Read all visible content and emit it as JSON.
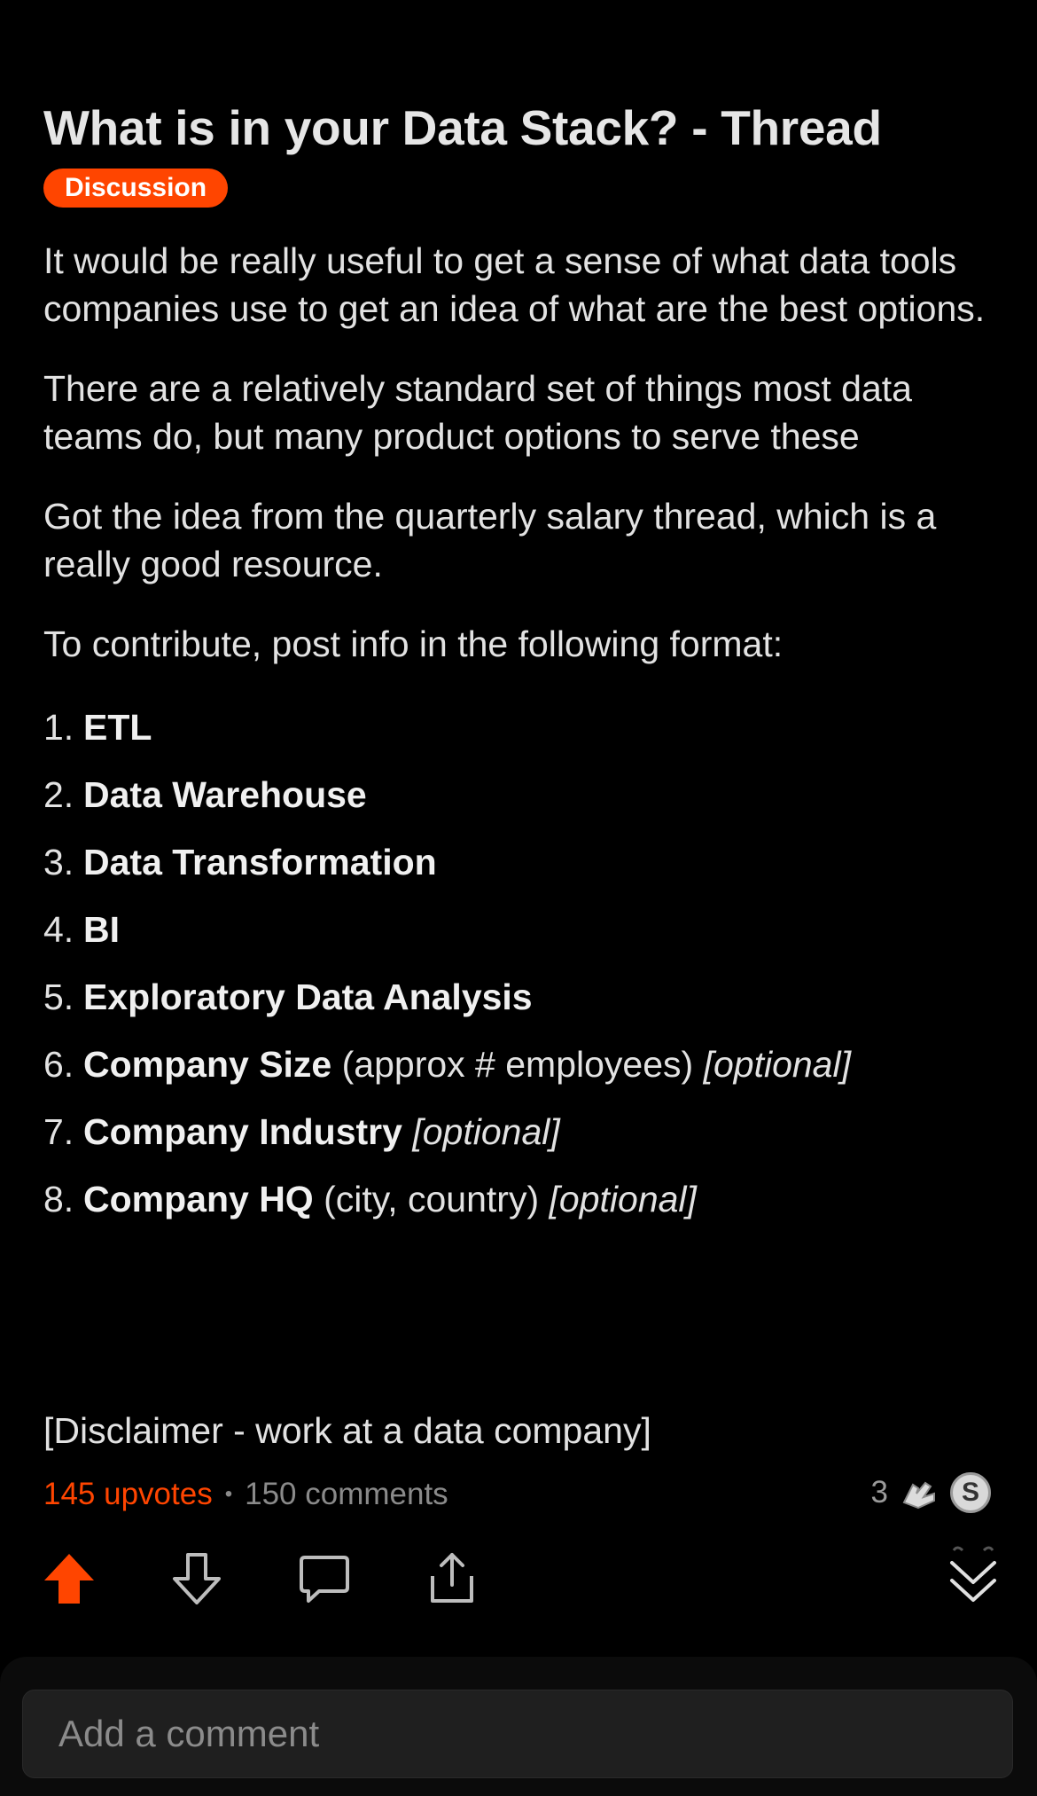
{
  "post": {
    "title": "What is in your Data Stack? - Thread",
    "flair": "Discussion",
    "paragraphs": [
      "It would be really useful to get a sense of what data tools companies use to get an idea of what are the best options.",
      "There are a relatively standard set of things most data teams do, but many product options to serve these",
      "Got the idea from the quarterly salary thread, which is a really good resource.",
      "To contribute, post info in the following format:"
    ],
    "list": [
      {
        "num": "1.",
        "bold": "ETL",
        "plain": "",
        "italic": ""
      },
      {
        "num": "2.",
        "bold": "Data Warehouse",
        "plain": "",
        "italic": ""
      },
      {
        "num": "3.",
        "bold": "Data Transformation",
        "plain": "",
        "italic": ""
      },
      {
        "num": "4.",
        "bold": "BI",
        "plain": "",
        "italic": ""
      },
      {
        "num": "5.",
        "bold": "Exploratory Data Analysis",
        "plain": "",
        "italic": ""
      },
      {
        "num": "6.",
        "bold": "Company Size",
        "plain": "(approx # employees)",
        "italic": "[optional]"
      },
      {
        "num": "7.",
        "bold": "Company Industry",
        "plain": "",
        "italic": "[optional]"
      },
      {
        "num": "8.",
        "bold": "Company HQ",
        "plain": "(city, country)",
        "italic": "[optional]"
      }
    ],
    "disclaimer": "[Disclaimer - work at a data company]",
    "upvotes": "145 upvotes",
    "separator": "•",
    "comments": "150 comments",
    "award_count": "3"
  },
  "actions": {
    "upvote_icon": "upvote-arrow-icon",
    "downvote_icon": "downvote-arrow-icon",
    "comment_icon": "comment-bubble-icon",
    "share_icon": "share-icon",
    "collapse_icon": "double-chevron-down-icon"
  },
  "comment_input": {
    "placeholder": "Add a comment"
  },
  "colors": {
    "accent": "#ff4500",
    "background": "#000000",
    "text": "#e2e2e2",
    "muted": "#8a8a8a"
  }
}
